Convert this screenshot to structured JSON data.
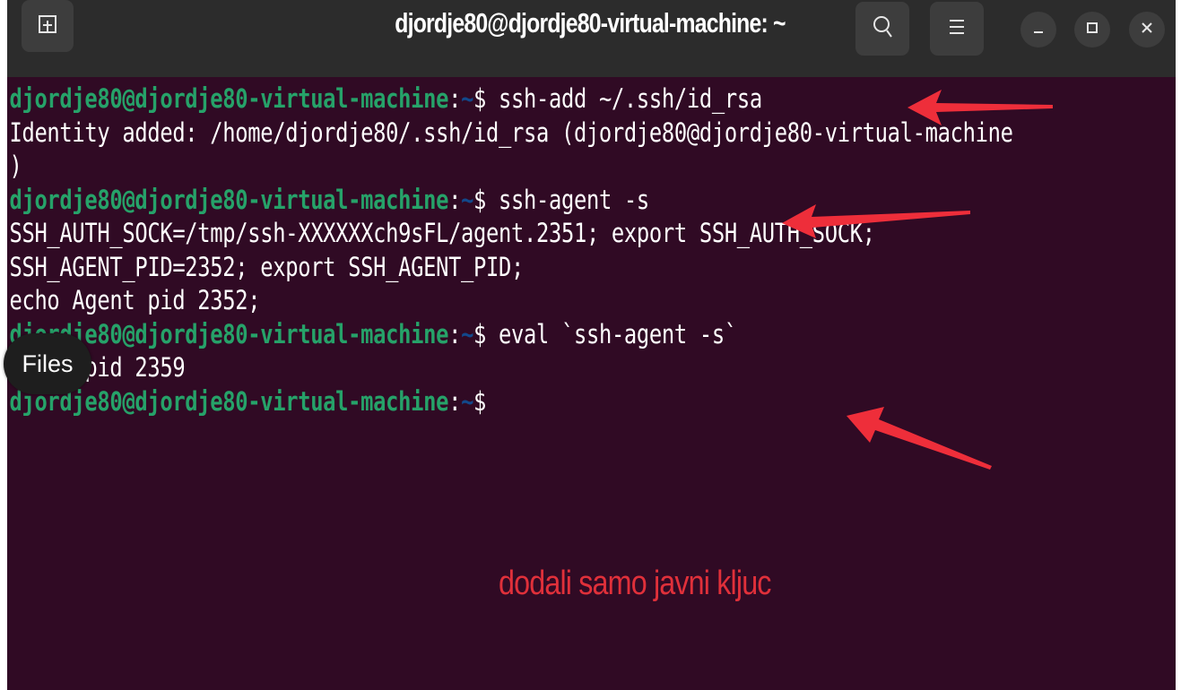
{
  "window": {
    "title": "djordje80@djordje80-virtual-machine: ~"
  },
  "icons": {
    "new_tab": "new-tab-icon",
    "search": "search-icon",
    "menu": "hamburger-menu-icon",
    "minimize": "minimize-icon",
    "maximize": "maximize-icon",
    "close": "close-icon"
  },
  "terminal": {
    "prompt_user": "djordje80@djordje80-virtual-machine",
    "prompt_sep": ":",
    "prompt_path": "~",
    "prompt_symbol": "$",
    "lines": [
      {
        "type": "cmd",
        "command": " ssh-add ~/.ssh/id_rsa"
      },
      {
        "type": "out",
        "text": "Identity added: /home/djordje80/.ssh/id_rsa (djordje80@djordje80-virtual-machine"
      },
      {
        "type": "out",
        "text": ")"
      },
      {
        "type": "cmd",
        "command": " ssh-agent -s"
      },
      {
        "type": "out",
        "text": "SSH_AUTH_SOCK=/tmp/ssh-XXXXXXch9sFL/agent.2351; export SSH_AUTH_SOCK;"
      },
      {
        "type": "out",
        "text": "SSH_AGENT_PID=2352; export SSH_AGENT_PID;"
      },
      {
        "type": "out",
        "text": "echo Agent pid 2352;"
      },
      {
        "type": "cmd",
        "command": " eval `ssh-agent -s`"
      },
      {
        "type": "out",
        "text": "Agent pid 2359"
      },
      {
        "type": "cmd",
        "command": ""
      }
    ]
  },
  "tooltip": {
    "files_label": "Files"
  },
  "annotation": {
    "text": "dodali samo javni kljuc",
    "color": "#e0303a"
  },
  "colors": {
    "terminal_bg": "#300a24",
    "prompt_user": "#26a269",
    "prompt_path": "#12488b",
    "titlebar_bg": "#2c2c2c"
  }
}
